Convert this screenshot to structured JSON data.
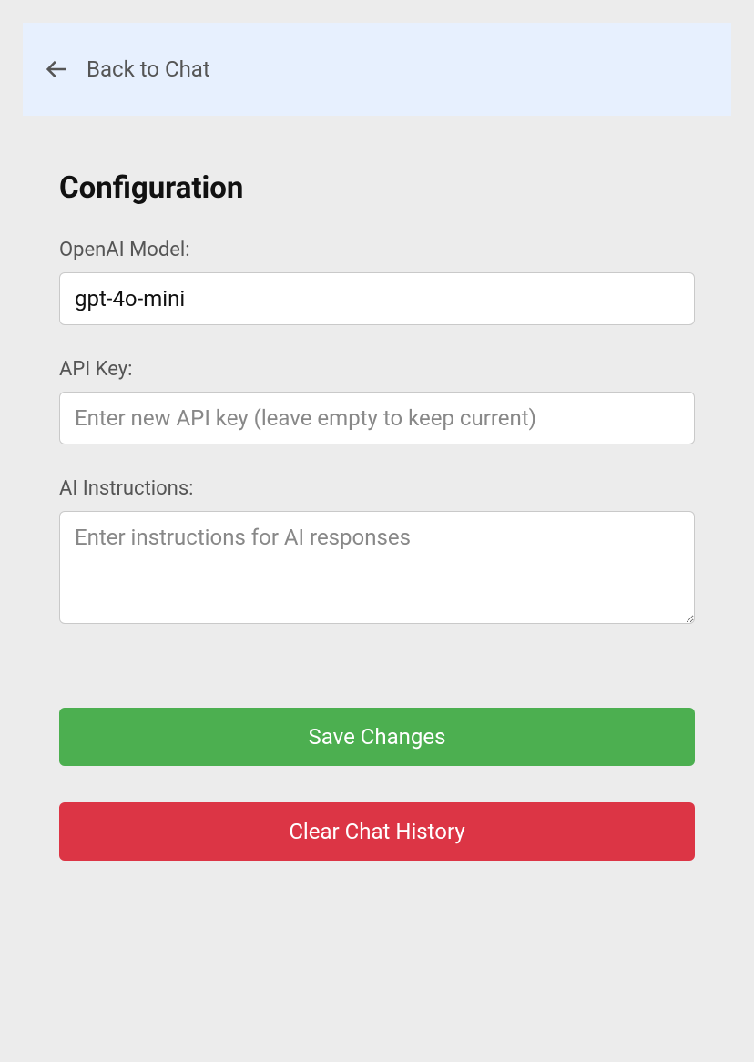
{
  "header": {
    "back_label": "Back to Chat"
  },
  "page": {
    "title": "Configuration"
  },
  "form": {
    "model": {
      "label": "OpenAI Model:",
      "value": "gpt-4o-mini"
    },
    "api_key": {
      "label": "API Key:",
      "placeholder": "Enter new API key (leave empty to keep current)",
      "value": ""
    },
    "instructions": {
      "label": "AI Instructions:",
      "placeholder": "Enter instructions for AI responses",
      "value": ""
    }
  },
  "actions": {
    "save_label": "Save Changes",
    "clear_label": "Clear Chat History"
  }
}
